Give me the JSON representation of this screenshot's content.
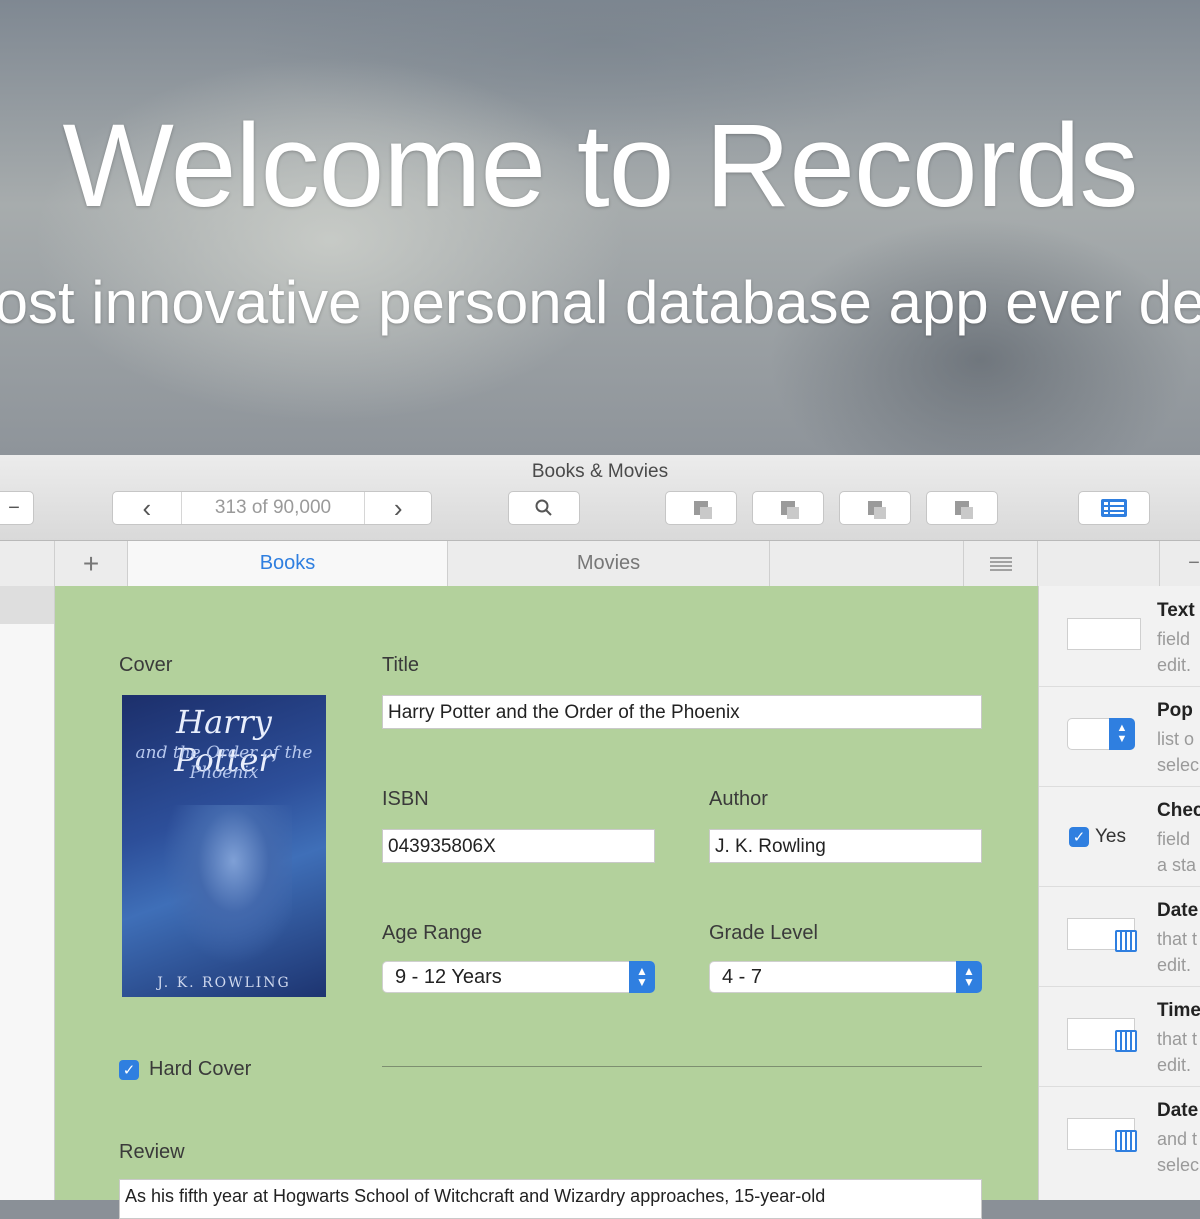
{
  "hero": {
    "title": "Welcome to Records",
    "subtitle": "ost innovative personal database app ever de"
  },
  "window": {
    "title": "Books & Movies",
    "record_counter": "313 of 90,000",
    "tabs": [
      {
        "label": "Books",
        "active": true
      },
      {
        "label": "Movies",
        "active": false
      }
    ],
    "add_tab_label": "+"
  },
  "form": {
    "cover_label": "Cover",
    "cover": {
      "title": "Harry Potter",
      "subtitle": "and the Order of the Phoenix",
      "author": "J. K. ROWLING"
    },
    "title_label": "Title",
    "title_value": "Harry Potter and the Order of the Phoenix",
    "isbn_label": "ISBN",
    "isbn_value": "043935806X",
    "author_label": "Author",
    "author_value": "J. K. Rowling",
    "age_label": "Age Range",
    "age_value": "9 - 12 Years",
    "grade_label": "Grade Level",
    "grade_value": "4 - 7",
    "hardcover_label": "Hard Cover",
    "hardcover_checked": true,
    "review_label": "Review",
    "review_value": "As his fifth year at Hogwarts School of Witchcraft and Wizardry approaches, 15-year-old"
  },
  "panel": {
    "items": [
      {
        "title": "Text",
        "desc": "field\nedit."
      },
      {
        "title": "Pop",
        "desc": "list o\nselec"
      },
      {
        "title": "Chec",
        "desc": "field\na sta",
        "check_label": "Yes"
      },
      {
        "title": "Date",
        "desc": "that t\nedit."
      },
      {
        "title": "Time",
        "desc": "that t\nedit."
      },
      {
        "title": "Date",
        "desc": "and t\nselec"
      }
    ]
  },
  "colors": {
    "accent": "#2f7fe0",
    "form_bg": "#b3d19c"
  }
}
